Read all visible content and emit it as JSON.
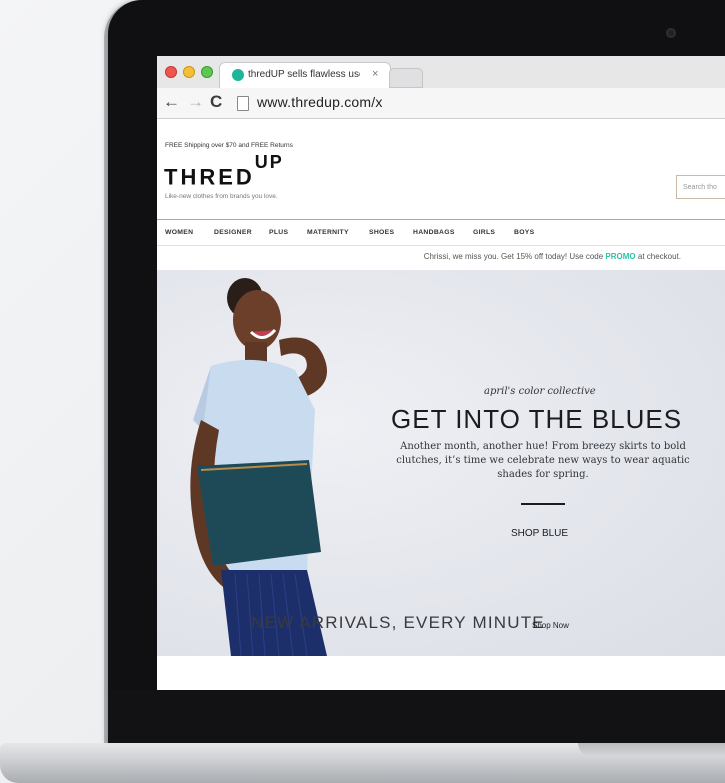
{
  "browser": {
    "tab_title": "thredUP sells flawless used",
    "tab_close": "×",
    "url": "www.thredup.com/x",
    "back": "←",
    "forward": "→",
    "reload": "C"
  },
  "site": {
    "promo_top": "FREE Shipping over $70 and FREE Returns",
    "logo_main": "THRED",
    "logo_sup": "UP",
    "tagline": "Like-new clothes from brands you love.",
    "search_placeholder": "Search tho",
    "nav": [
      "WOMEN",
      "DESIGNER",
      "PLUS",
      "MATERNITY",
      "SHOES",
      "HANDBAGS",
      "GIRLS",
      "BOYS"
    ],
    "promo_prefix": "Chrissi, we miss you. Get 15% off today! Use code ",
    "promo_code": "PROMO",
    "promo_suffix": " at checkout."
  },
  "hero": {
    "subtitle": "april's color collective",
    "title": "GET INTO THE BLUES",
    "description": "Another month, another hue! From breezy skirts to bold clutches, it’s time we celebrate new ways to wear aquatic shades for spring.",
    "cta": "SHOP BLUE"
  },
  "footer_band": {
    "title": "NEW ARRIVALS, EVERY MINUTE",
    "link": "Shop Now"
  },
  "colors": {
    "accent": "#2cc3a6",
    "hero_bg": "#e4e6ed",
    "laptop_bezel": "#101012"
  }
}
